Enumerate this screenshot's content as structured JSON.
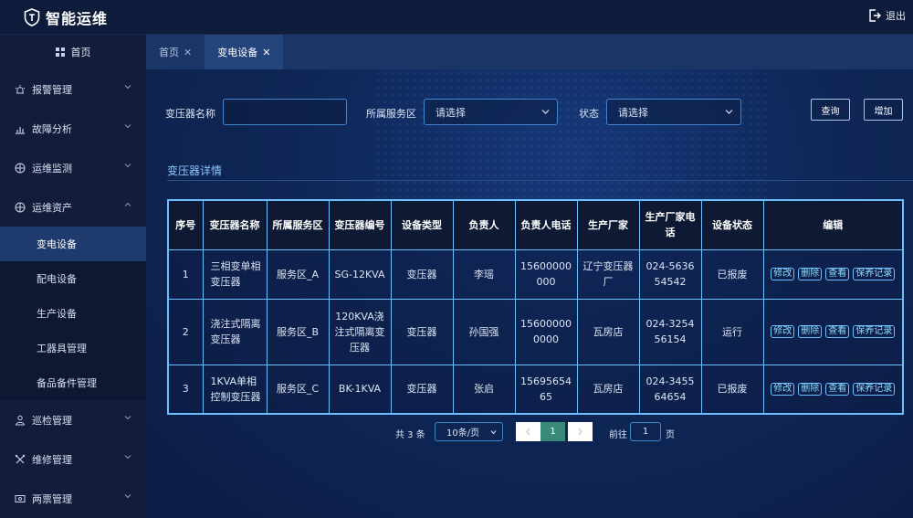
{
  "app": {
    "title": "智能运维",
    "logout_label": "退出"
  },
  "sidebar": {
    "home_label": "首页",
    "menus": [
      {
        "label": "报警管理",
        "icon": "alarm-icon"
      },
      {
        "label": "故障分析",
        "icon": "bar-chart-icon"
      },
      {
        "label": "运维监测",
        "icon": "monitor-icon"
      },
      {
        "label": "运维资产",
        "icon": "asset-icon"
      }
    ],
    "asset_sub": [
      {
        "label": "变电设备",
        "active": true
      },
      {
        "label": "配电设备"
      },
      {
        "label": "生产设备"
      },
      {
        "label": "工器具管理"
      },
      {
        "label": "备品备件管理"
      }
    ],
    "menus_bottom": [
      {
        "label": "巡检管理",
        "icon": "inspection-icon"
      },
      {
        "label": "维修管理",
        "icon": "wrench-icon"
      },
      {
        "label": "两票管理",
        "icon": "ticket-icon"
      }
    ]
  },
  "tabs": [
    {
      "label": "首页",
      "active": false
    },
    {
      "label": "变电设备",
      "active": true
    }
  ],
  "filters": {
    "name_label": "变压器名称",
    "name_value": "",
    "area_label": "所属服务区",
    "area_value": "请选择",
    "status_label": "状态",
    "status_value": "请选择",
    "query_button": "查询",
    "add_button": "增加"
  },
  "section_title": "变压器详情",
  "table": {
    "headers": [
      "序号",
      "变压器名称",
      "所属服务区",
      "变压器编号",
      "设备类型",
      "负责人",
      "负责人电话",
      "生产厂家",
      "生产厂家电话",
      "设备状态",
      "编辑"
    ],
    "rows": [
      [
        "1",
        "三相变单相变压器",
        "服务区_A",
        "SG-12KVA",
        "变压器",
        "李瑶",
        "15600000000",
        "辽宁变压器厂",
        "024-563654542",
        "已报废"
      ],
      [
        "2",
        "浇注式隔离变压器",
        "服务区_B",
        "120KVA浇注式隔离变压器",
        "变压器",
        "孙国强",
        "156000000000",
        "瓦房店",
        "024-325456154",
        "运行"
      ],
      [
        "3",
        "1KVA单相控制变压器",
        "服务区_C",
        "BK-1KVA",
        "变压器",
        "张启",
        "1569565465",
        "瓦房店",
        "024-345564654",
        "已报废"
      ]
    ],
    "actions": [
      "修改",
      "删除",
      "查看",
      "保养记录"
    ]
  },
  "pagination": {
    "total_text": "共 3 条",
    "page_size": "10条/页",
    "current_page": "1",
    "goto_label": "前往",
    "goto_value": "1",
    "page_suffix": "页"
  },
  "colors": {
    "sidebar_bg": "#111d3a",
    "active_sub_bg": "#1f3b6e",
    "table_border": "#6bc0ff",
    "section_title": "#8fc7ff",
    "current_page": "#3a8a7a"
  }
}
